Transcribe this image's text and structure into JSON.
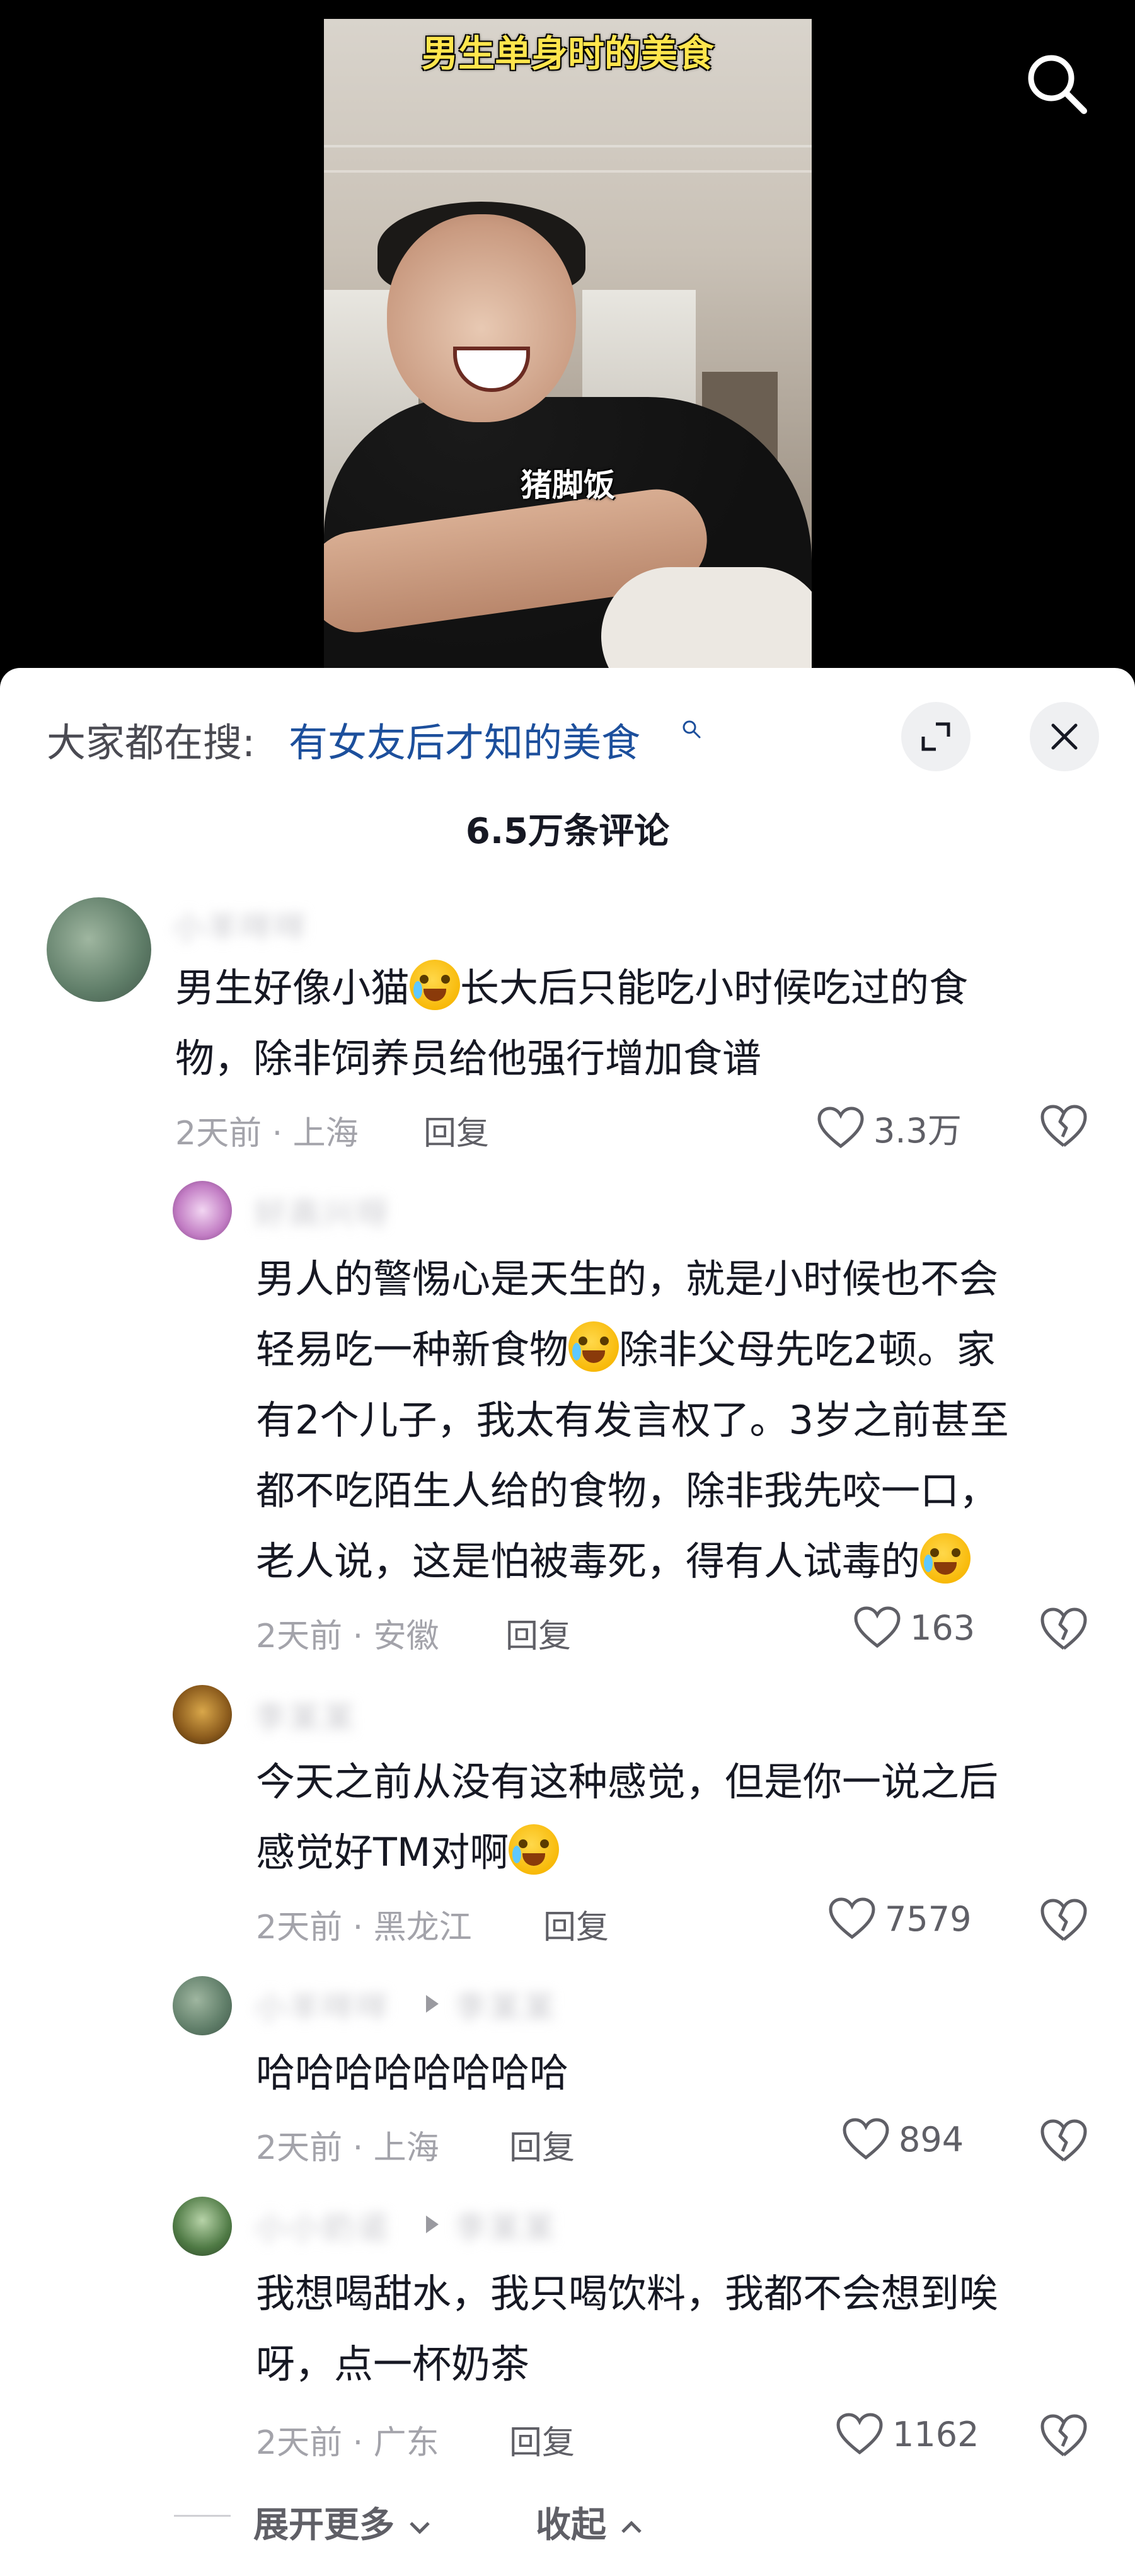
{
  "video": {
    "title": "男生单身时的美食",
    "subtitle": "猪脚饭"
  },
  "header": {
    "search_prefix": "大家都在搜:",
    "search_keyword": "有女友后才知的美食",
    "comment_count": "6.5万条评论"
  },
  "icons": {
    "search": "search-icon",
    "expand": "expand-icon",
    "close": "close-icon",
    "like": "heart-outline-icon",
    "dislike": "broken-heart-icon",
    "emoji": "crying-laughing-emoji"
  },
  "colors": {
    "link": "#1c4f9c",
    "title_yellow": "#ffe64d",
    "muted": "#a3a3aa"
  },
  "comments": [
    {
      "text_1": "男生好像小猫",
      "text_2": "长大后只能吃小时候吃过的食",
      "text_3": "物，除非饲养员给他强行增加食谱",
      "time_location": "2天前 · 上海",
      "reply_label": "回复",
      "likes": "3.3万"
    },
    {
      "line_1": "男人的警惕心是天生的，就是小时候也不会",
      "line_2a": "轻易吃一种新食物",
      "line_2b": "除非父母先吃2顿。家",
      "line_3": "有2个儿子，我太有发言权了。3岁之前甚至",
      "line_4": "都不吃陌生人给的食物，除非我先咬一口，",
      "line_5": "老人说，这是怕被毒死，得有人试毒的",
      "time_location": "2天前 · 安徽",
      "reply_label": "回复",
      "likes": "163"
    },
    {
      "line_1": "今天之前从没有这种感觉，但是你一说之后",
      "line_2": "感觉好TM对啊",
      "time_location": "2天前 · 黑龙江",
      "reply_label": "回复",
      "likes": "7579"
    },
    {
      "line_1": "哈哈哈哈哈哈哈哈",
      "time_location": "2天前 · 上海",
      "reply_label": "回复",
      "likes": "894"
    },
    {
      "line_1": "我想喝甜水，我只喝饮料，我都不会想到唉",
      "line_2": "呀，点一杯奶茶",
      "time_location": "2天前 · 广东",
      "reply_label": "回复",
      "likes": "1162"
    }
  ],
  "footer": {
    "expand_more": "展开更多",
    "collapse": "收起"
  }
}
